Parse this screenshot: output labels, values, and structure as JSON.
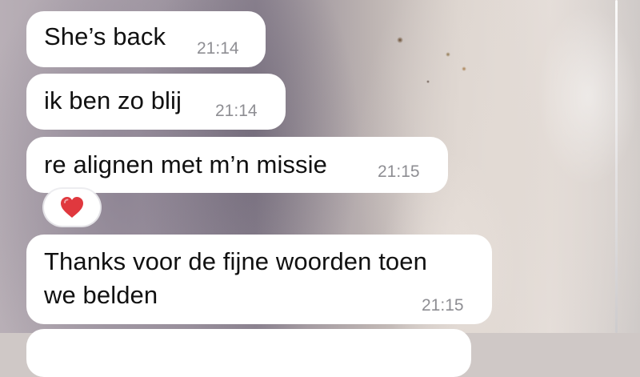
{
  "chat": {
    "messages": [
      {
        "text": "She’s back",
        "time": "21:14"
      },
      {
        "text": "ik ben zo blij",
        "time": "21:14"
      },
      {
        "text": "re alignen met m’n missie",
        "time": "21:15",
        "reaction": {
          "icon": "heart-icon",
          "color": "#e0383e"
        }
      },
      {
        "lines": [
          "Thanks voor de fijne woorden toen",
          "we belden"
        ],
        "time": "21:15"
      }
    ]
  },
  "colors": {
    "bubble": "#ffffff",
    "text": "#111111",
    "timestamp": "#8e8e93",
    "heart": "#e0383e"
  }
}
